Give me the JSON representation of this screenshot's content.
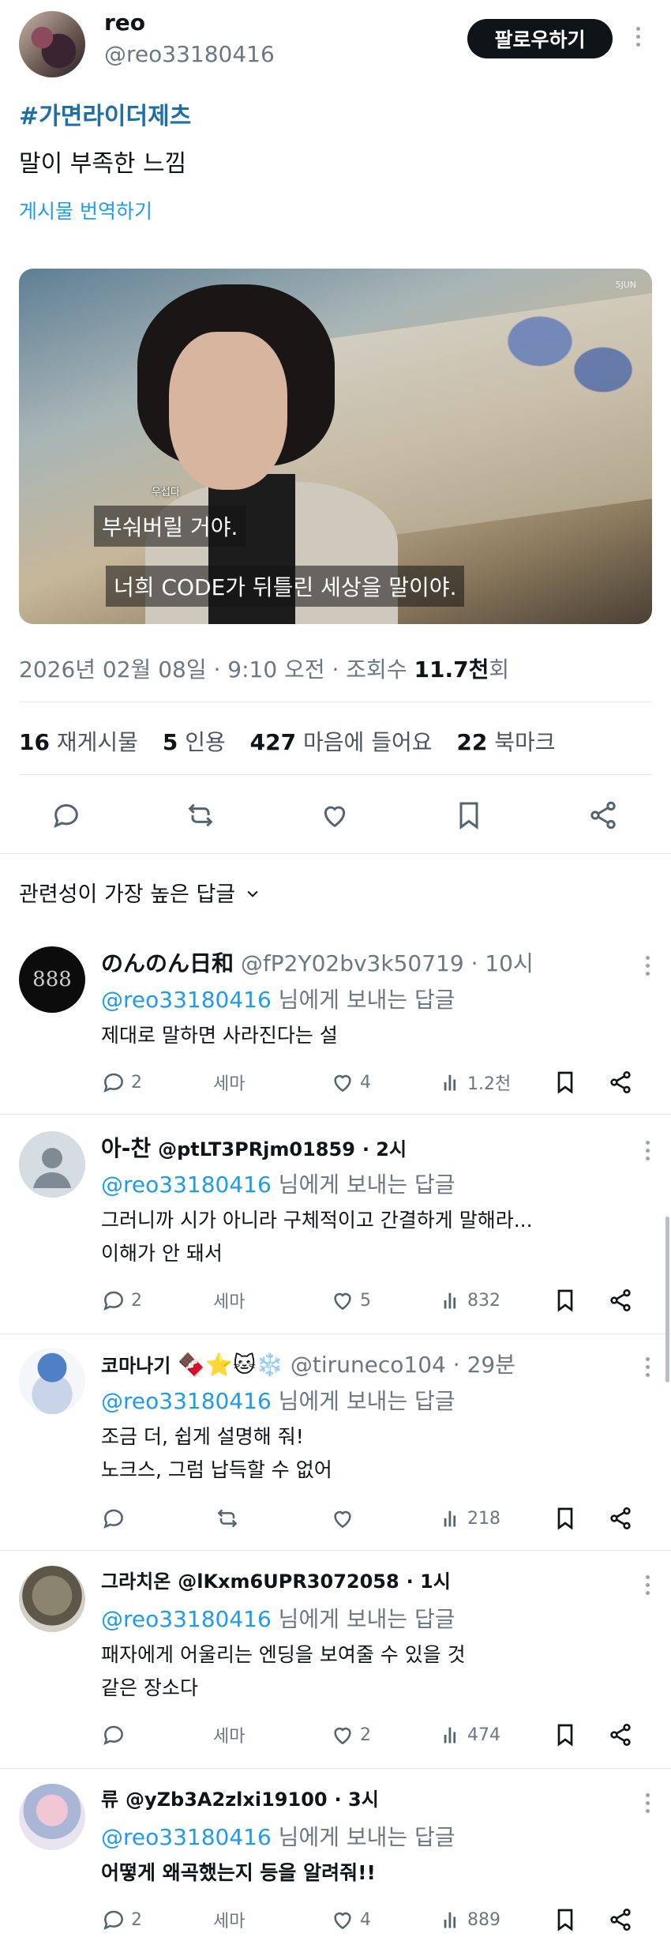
{
  "post": {
    "author_name": "reo",
    "author_handle": "@reo33180416",
    "follow_label": "팔로우하기",
    "hashtag": "#가면라이더제츠",
    "text": "말이 부족한 느낌",
    "translate_label": "게시물 번역하기",
    "media": {
      "small_caption": "우섭다",
      "subtitle_1": "부숴버릴 거야.",
      "subtitle_2": "너희 CODE가 뒤틀린 세상을 말이야.",
      "watermark": "5JUN"
    },
    "meta": {
      "timestamp": "2026년 02월 08일 · 9:10 오전 · 조회수 ",
      "views_value": "11.7천",
      "views_suffix": "회"
    },
    "stats": {
      "reposts_num": "16",
      "reposts_label": "재게시물",
      "quotes_num": "5",
      "quotes_label": "인용",
      "likes_num": "427",
      "likes_label": "마음에 들어요",
      "bookmarks_num": "22",
      "bookmarks_label": "북마크"
    },
    "actions": [
      "reply-icon",
      "repost-icon",
      "like-icon",
      "bookmark-icon",
      "share-icon"
    ]
  },
  "sort": {
    "label": "관련성이 가장 높은 답글"
  },
  "colors": {
    "accent": "#1d9bf0",
    "text": "#0f1419",
    "muted": "#6b7782",
    "follow_bg": "#0f1419"
  },
  "replies": [
    {
      "name": "のんのん日和",
      "handle": "@fP2Y02bv3k50719",
      "time": "· 10시",
      "mention": "@reo33180416",
      "to_label": " 님에게 보내는 답글",
      "body_1": "제대로 말하면 사라진다는 설",
      "body_2": "",
      "reply_count": "2",
      "repost_label": "세마",
      "like_count": "4",
      "views": "1.2천"
    },
    {
      "name": "아-찬",
      "handle": "@ptLT3PRjm01859",
      "time": "· 2시",
      "mention": "@reo33180416",
      "to_label": " 님에게 보내는 답글",
      "body_1": "그러니까 시가 아니라 구체적이고 간결하게 말해라...",
      "body_2": "이해가 안 돼서",
      "reply_count": "2",
      "repost_label": "세마",
      "like_count": "5",
      "views": "832"
    },
    {
      "name": "코마나기",
      "emoji": "🍫⭐🐱❄️",
      "handle": "@tiruneco104",
      "time": "· 29분",
      "mention": "@reo33180416",
      "to_label": " 님에게 보내는 답글",
      "body_1": "조금 더, 쉽게 설명해 줘!",
      "body_2": "노크스, 그럼 납득할 수 없어",
      "reply_count": "",
      "repost_label": "",
      "like_count": "",
      "views": "218"
    },
    {
      "name": "그라치온",
      "handle": "@lKxm6UPR3072058",
      "time": "· 1시",
      "mention": "@reo33180416",
      "to_label": " 님에게 보내는 답글",
      "body_1": "패자에게 어울리는 엔딩을 보여줄 수 있을 것",
      "body_2": "같은 장소다",
      "reply_count": "",
      "repost_label": "세마",
      "like_count": "2",
      "views": "474"
    },
    {
      "name": "류",
      "handle": "@yZb3A2zlxi19100",
      "time": "· 3시",
      "mention": "@reo33180416",
      "to_label": " 님에게 보내는 답글",
      "body_1": "어떻게 왜곡했는지 등을 알려줘!!",
      "body_2": "",
      "reply_count": "2",
      "repost_label": "세마",
      "like_count": "4",
      "views": "889"
    }
  ]
}
